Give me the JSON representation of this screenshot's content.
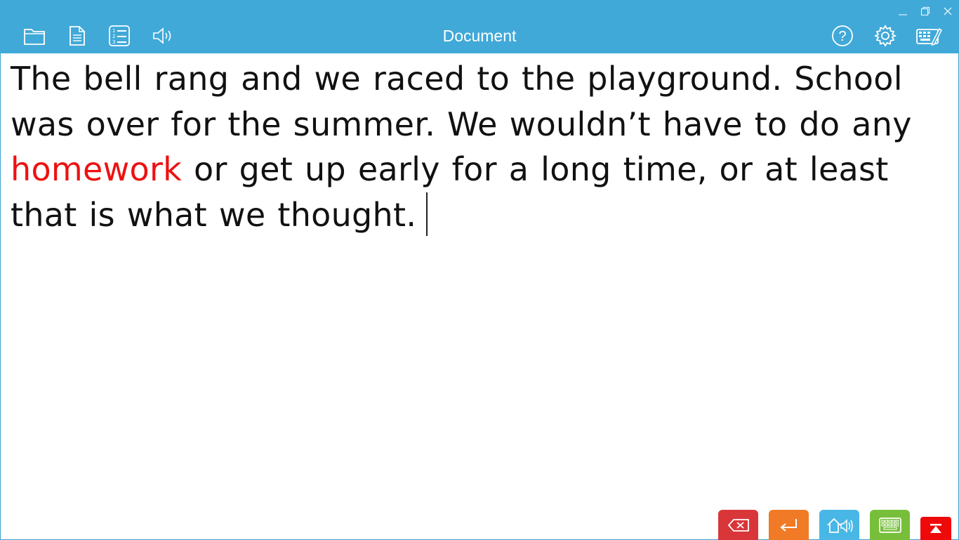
{
  "window": {
    "title": "Document",
    "controls": [
      "minimize-icon",
      "restore-icon",
      "close-icon"
    ]
  },
  "toolbar_left": [
    {
      "name": "open-folder-icon"
    },
    {
      "name": "document-icon"
    },
    {
      "name": "numbered-list-icon"
    },
    {
      "name": "speaker-icon"
    }
  ],
  "toolbar_right": [
    {
      "name": "help-icon"
    },
    {
      "name": "settings-gear-icon"
    },
    {
      "name": "keyboard-edit-icon"
    }
  ],
  "document": {
    "text_before": "The bell rang and we raced to the playground. School was over for the summer. We wouldn’t have to do any ",
    "highlighted_word": "homework",
    "text_after": " or get up early for a long time, or at least that is what we thought."
  },
  "bottom_buttons": [
    {
      "name": "backspace-button",
      "color": "#d9363a"
    },
    {
      "name": "enter-button",
      "color": "#f07a26"
    },
    {
      "name": "speak-button",
      "color": "#49b7e6"
    },
    {
      "name": "keyboard-button",
      "color": "#77bf3a"
    },
    {
      "name": "collapse-button",
      "color": "#ee0a0a"
    }
  ],
  "colors": {
    "titlebar": "#40a9d8",
    "highlight": "#ee1111"
  }
}
